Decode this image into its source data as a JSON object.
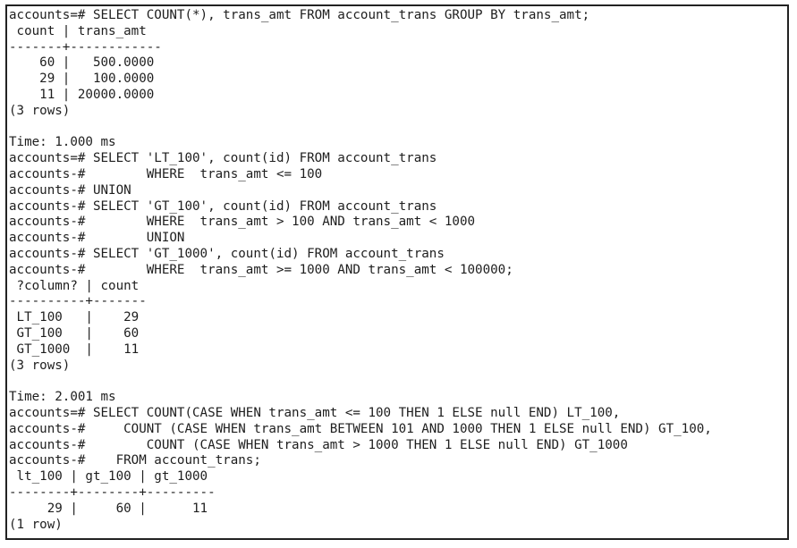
{
  "terminal": {
    "lines": [
      "accounts=# SELECT COUNT(*), trans_amt FROM account_trans GROUP BY trans_amt;",
      " count | trans_amt",
      "-------+------------",
      "    60 |   500.0000",
      "    29 |   100.0000",
      "    11 | 20000.0000",
      "(3 rows)",
      "",
      "Time: 1.000 ms",
      "accounts=# SELECT 'LT_100', count(id) FROM account_trans",
      "accounts-#        WHERE  trans_amt <= 100",
      "accounts-# UNION",
      "accounts-# SELECT 'GT_100', count(id) FROM account_trans",
      "accounts-#        WHERE  trans_amt > 100 AND trans_amt < 1000",
      "accounts-#        UNION",
      "accounts-# SELECT 'GT_1000', count(id) FROM account_trans",
      "accounts-#        WHERE  trans_amt >= 1000 AND trans_amt < 100000;",
      " ?column? | count",
      "----------+-------",
      " LT_100   |    29",
      " GT_100   |    60",
      " GT_1000  |    11",
      "(3 rows)",
      "",
      "Time: 2.001 ms",
      "accounts=# SELECT COUNT(CASE WHEN trans_amt <= 100 THEN 1 ELSE null END) LT_100,",
      "accounts-#     COUNT (CASE WHEN trans_amt BETWEEN 101 AND 1000 THEN 1 ELSE null END) GT_100,",
      "accounts-#        COUNT (CASE WHEN trans_amt > 1000 THEN 1 ELSE null END) GT_1000",
      "accounts-#    FROM account_trans;",
      " lt_100 | gt_100 | gt_1000",
      "--------+--------+---------",
      "     29 |     60 |      11",
      "(1 row)"
    ]
  }
}
